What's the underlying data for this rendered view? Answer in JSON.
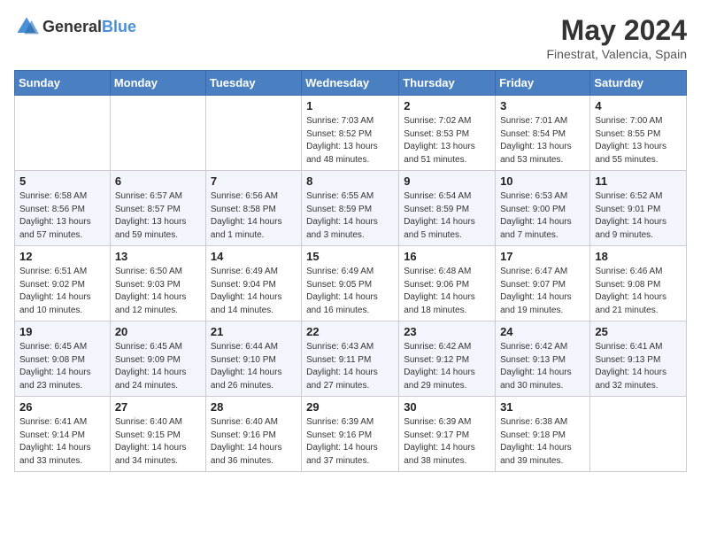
{
  "header": {
    "logo_general": "General",
    "logo_blue": "Blue",
    "month_year": "May 2024",
    "location": "Finestrat, Valencia, Spain"
  },
  "days_of_week": [
    "Sunday",
    "Monday",
    "Tuesday",
    "Wednesday",
    "Thursday",
    "Friday",
    "Saturday"
  ],
  "weeks": [
    [
      {
        "day": "",
        "data": null
      },
      {
        "day": "",
        "data": null
      },
      {
        "day": "",
        "data": null
      },
      {
        "day": "1",
        "data": {
          "sunrise": "7:03 AM",
          "sunset": "8:52 PM",
          "daylight": "13 hours and 48 minutes."
        }
      },
      {
        "day": "2",
        "data": {
          "sunrise": "7:02 AM",
          "sunset": "8:53 PM",
          "daylight": "13 hours and 51 minutes."
        }
      },
      {
        "day": "3",
        "data": {
          "sunrise": "7:01 AM",
          "sunset": "8:54 PM",
          "daylight": "13 hours and 53 minutes."
        }
      },
      {
        "day": "4",
        "data": {
          "sunrise": "7:00 AM",
          "sunset": "8:55 PM",
          "daylight": "13 hours and 55 minutes."
        }
      }
    ],
    [
      {
        "day": "5",
        "data": {
          "sunrise": "6:58 AM",
          "sunset": "8:56 PM",
          "daylight": "13 hours and 57 minutes."
        }
      },
      {
        "day": "6",
        "data": {
          "sunrise": "6:57 AM",
          "sunset": "8:57 PM",
          "daylight": "13 hours and 59 minutes."
        }
      },
      {
        "day": "7",
        "data": {
          "sunrise": "6:56 AM",
          "sunset": "8:58 PM",
          "daylight": "14 hours and 1 minute."
        }
      },
      {
        "day": "8",
        "data": {
          "sunrise": "6:55 AM",
          "sunset": "8:59 PM",
          "daylight": "14 hours and 3 minutes."
        }
      },
      {
        "day": "9",
        "data": {
          "sunrise": "6:54 AM",
          "sunset": "8:59 PM",
          "daylight": "14 hours and 5 minutes."
        }
      },
      {
        "day": "10",
        "data": {
          "sunrise": "6:53 AM",
          "sunset": "9:00 PM",
          "daylight": "14 hours and 7 minutes."
        }
      },
      {
        "day": "11",
        "data": {
          "sunrise": "6:52 AM",
          "sunset": "9:01 PM",
          "daylight": "14 hours and 9 minutes."
        }
      }
    ],
    [
      {
        "day": "12",
        "data": {
          "sunrise": "6:51 AM",
          "sunset": "9:02 PM",
          "daylight": "14 hours and 10 minutes."
        }
      },
      {
        "day": "13",
        "data": {
          "sunrise": "6:50 AM",
          "sunset": "9:03 PM",
          "daylight": "14 hours and 12 minutes."
        }
      },
      {
        "day": "14",
        "data": {
          "sunrise": "6:49 AM",
          "sunset": "9:04 PM",
          "daylight": "14 hours and 14 minutes."
        }
      },
      {
        "day": "15",
        "data": {
          "sunrise": "6:49 AM",
          "sunset": "9:05 PM",
          "daylight": "14 hours and 16 minutes."
        }
      },
      {
        "day": "16",
        "data": {
          "sunrise": "6:48 AM",
          "sunset": "9:06 PM",
          "daylight": "14 hours and 18 minutes."
        }
      },
      {
        "day": "17",
        "data": {
          "sunrise": "6:47 AM",
          "sunset": "9:07 PM",
          "daylight": "14 hours and 19 minutes."
        }
      },
      {
        "day": "18",
        "data": {
          "sunrise": "6:46 AM",
          "sunset": "9:08 PM",
          "daylight": "14 hours and 21 minutes."
        }
      }
    ],
    [
      {
        "day": "19",
        "data": {
          "sunrise": "6:45 AM",
          "sunset": "9:08 PM",
          "daylight": "14 hours and 23 minutes."
        }
      },
      {
        "day": "20",
        "data": {
          "sunrise": "6:45 AM",
          "sunset": "9:09 PM",
          "daylight": "14 hours and 24 minutes."
        }
      },
      {
        "day": "21",
        "data": {
          "sunrise": "6:44 AM",
          "sunset": "9:10 PM",
          "daylight": "14 hours and 26 minutes."
        }
      },
      {
        "day": "22",
        "data": {
          "sunrise": "6:43 AM",
          "sunset": "9:11 PM",
          "daylight": "14 hours and 27 minutes."
        }
      },
      {
        "day": "23",
        "data": {
          "sunrise": "6:42 AM",
          "sunset": "9:12 PM",
          "daylight": "14 hours and 29 minutes."
        }
      },
      {
        "day": "24",
        "data": {
          "sunrise": "6:42 AM",
          "sunset": "9:13 PM",
          "daylight": "14 hours and 30 minutes."
        }
      },
      {
        "day": "25",
        "data": {
          "sunrise": "6:41 AM",
          "sunset": "9:13 PM",
          "daylight": "14 hours and 32 minutes."
        }
      }
    ],
    [
      {
        "day": "26",
        "data": {
          "sunrise": "6:41 AM",
          "sunset": "9:14 PM",
          "daylight": "14 hours and 33 minutes."
        }
      },
      {
        "day": "27",
        "data": {
          "sunrise": "6:40 AM",
          "sunset": "9:15 PM",
          "daylight": "14 hours and 34 minutes."
        }
      },
      {
        "day": "28",
        "data": {
          "sunrise": "6:40 AM",
          "sunset": "9:16 PM",
          "daylight": "14 hours and 36 minutes."
        }
      },
      {
        "day": "29",
        "data": {
          "sunrise": "6:39 AM",
          "sunset": "9:16 PM",
          "daylight": "14 hours and 37 minutes."
        }
      },
      {
        "day": "30",
        "data": {
          "sunrise": "6:39 AM",
          "sunset": "9:17 PM",
          "daylight": "14 hours and 38 minutes."
        }
      },
      {
        "day": "31",
        "data": {
          "sunrise": "6:38 AM",
          "sunset": "9:18 PM",
          "daylight": "14 hours and 39 minutes."
        }
      },
      {
        "day": "",
        "data": null
      }
    ]
  ]
}
